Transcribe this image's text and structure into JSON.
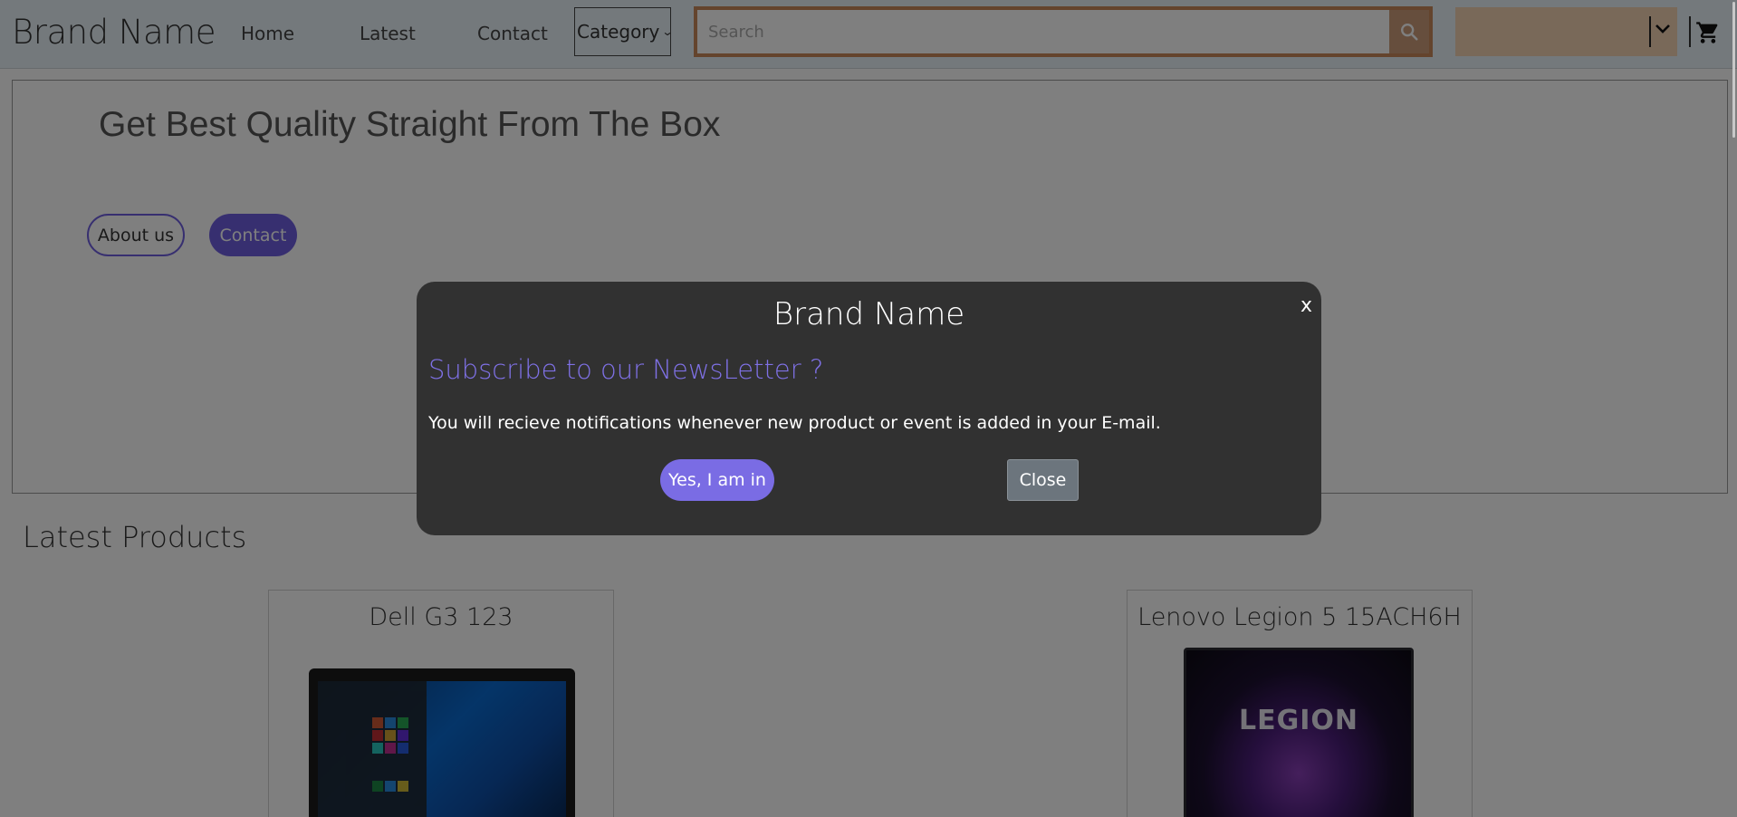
{
  "navbar": {
    "brand": "Brand Name",
    "links": [
      "Home",
      "Latest",
      "Contact"
    ],
    "category_label": "Category",
    "search_placeholder": "Search"
  },
  "hero": {
    "title": "Get Best Quality Straight From The Box",
    "about_label": "About us",
    "contact_label": "Contact"
  },
  "latest": {
    "title": "Latest Products",
    "products": [
      {
        "name": "Dell G3 123"
      },
      {
        "name": "Lenovo Legion 5 15ACH6H"
      }
    ],
    "legion_logo_text": "LEGION"
  },
  "modal": {
    "brand": "Brand Name",
    "close_x": "x",
    "heading": "Subscribe to our NewsLetter ?",
    "body": "You will recieve notifications whenever new product or event is added in your E-mail.",
    "yes_label": "Yes, I am in",
    "close_label": "Close"
  },
  "colors": {
    "accent": "#6f5fe0",
    "modal_bg": "#313131",
    "search_border": "#c9885a"
  }
}
